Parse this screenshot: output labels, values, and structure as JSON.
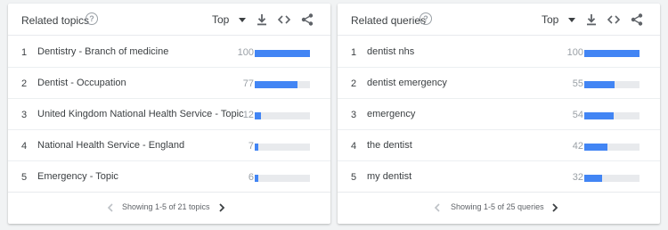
{
  "colors": {
    "bar": "#4285f4",
    "track": "#e8eaed",
    "text": "#3c4043",
    "muted": "#9aa0a6"
  },
  "topics": {
    "title": "Related topics",
    "help_icon": "?",
    "filter": "Top",
    "rows": [
      {
        "index": "1",
        "label": "Dentistry - Branch of medicine",
        "value": "100",
        "level": 1.0
      },
      {
        "index": "2",
        "label": "Dentist - Occupation",
        "value": "77",
        "level": 0.77
      },
      {
        "index": "3",
        "label": "United Kingdom National Health Service - Topic",
        "value": "12",
        "level": 0.12
      },
      {
        "index": "4",
        "label": "National Health Service - England",
        "value": "7",
        "level": 0.07
      },
      {
        "index": "5",
        "label": "Emergency - Topic",
        "value": "6",
        "level": 0.06
      }
    ],
    "pager": "Showing 1-5 of 21 topics"
  },
  "queries": {
    "title": "Related queries",
    "help_icon": "?",
    "filter": "Top",
    "rows": [
      {
        "index": "1",
        "label": "dentist nhs",
        "value": "100",
        "level": 1.0
      },
      {
        "index": "2",
        "label": "dentist emergency",
        "value": "55",
        "level": 0.55
      },
      {
        "index": "3",
        "label": "emergency",
        "value": "54",
        "level": 0.54
      },
      {
        "index": "4",
        "label": "the dentist",
        "value": "42",
        "level": 0.42
      },
      {
        "index": "5",
        "label": "my dentist",
        "value": "32",
        "level": 0.32
      }
    ],
    "pager": "Showing 1-5 of 25 queries"
  }
}
